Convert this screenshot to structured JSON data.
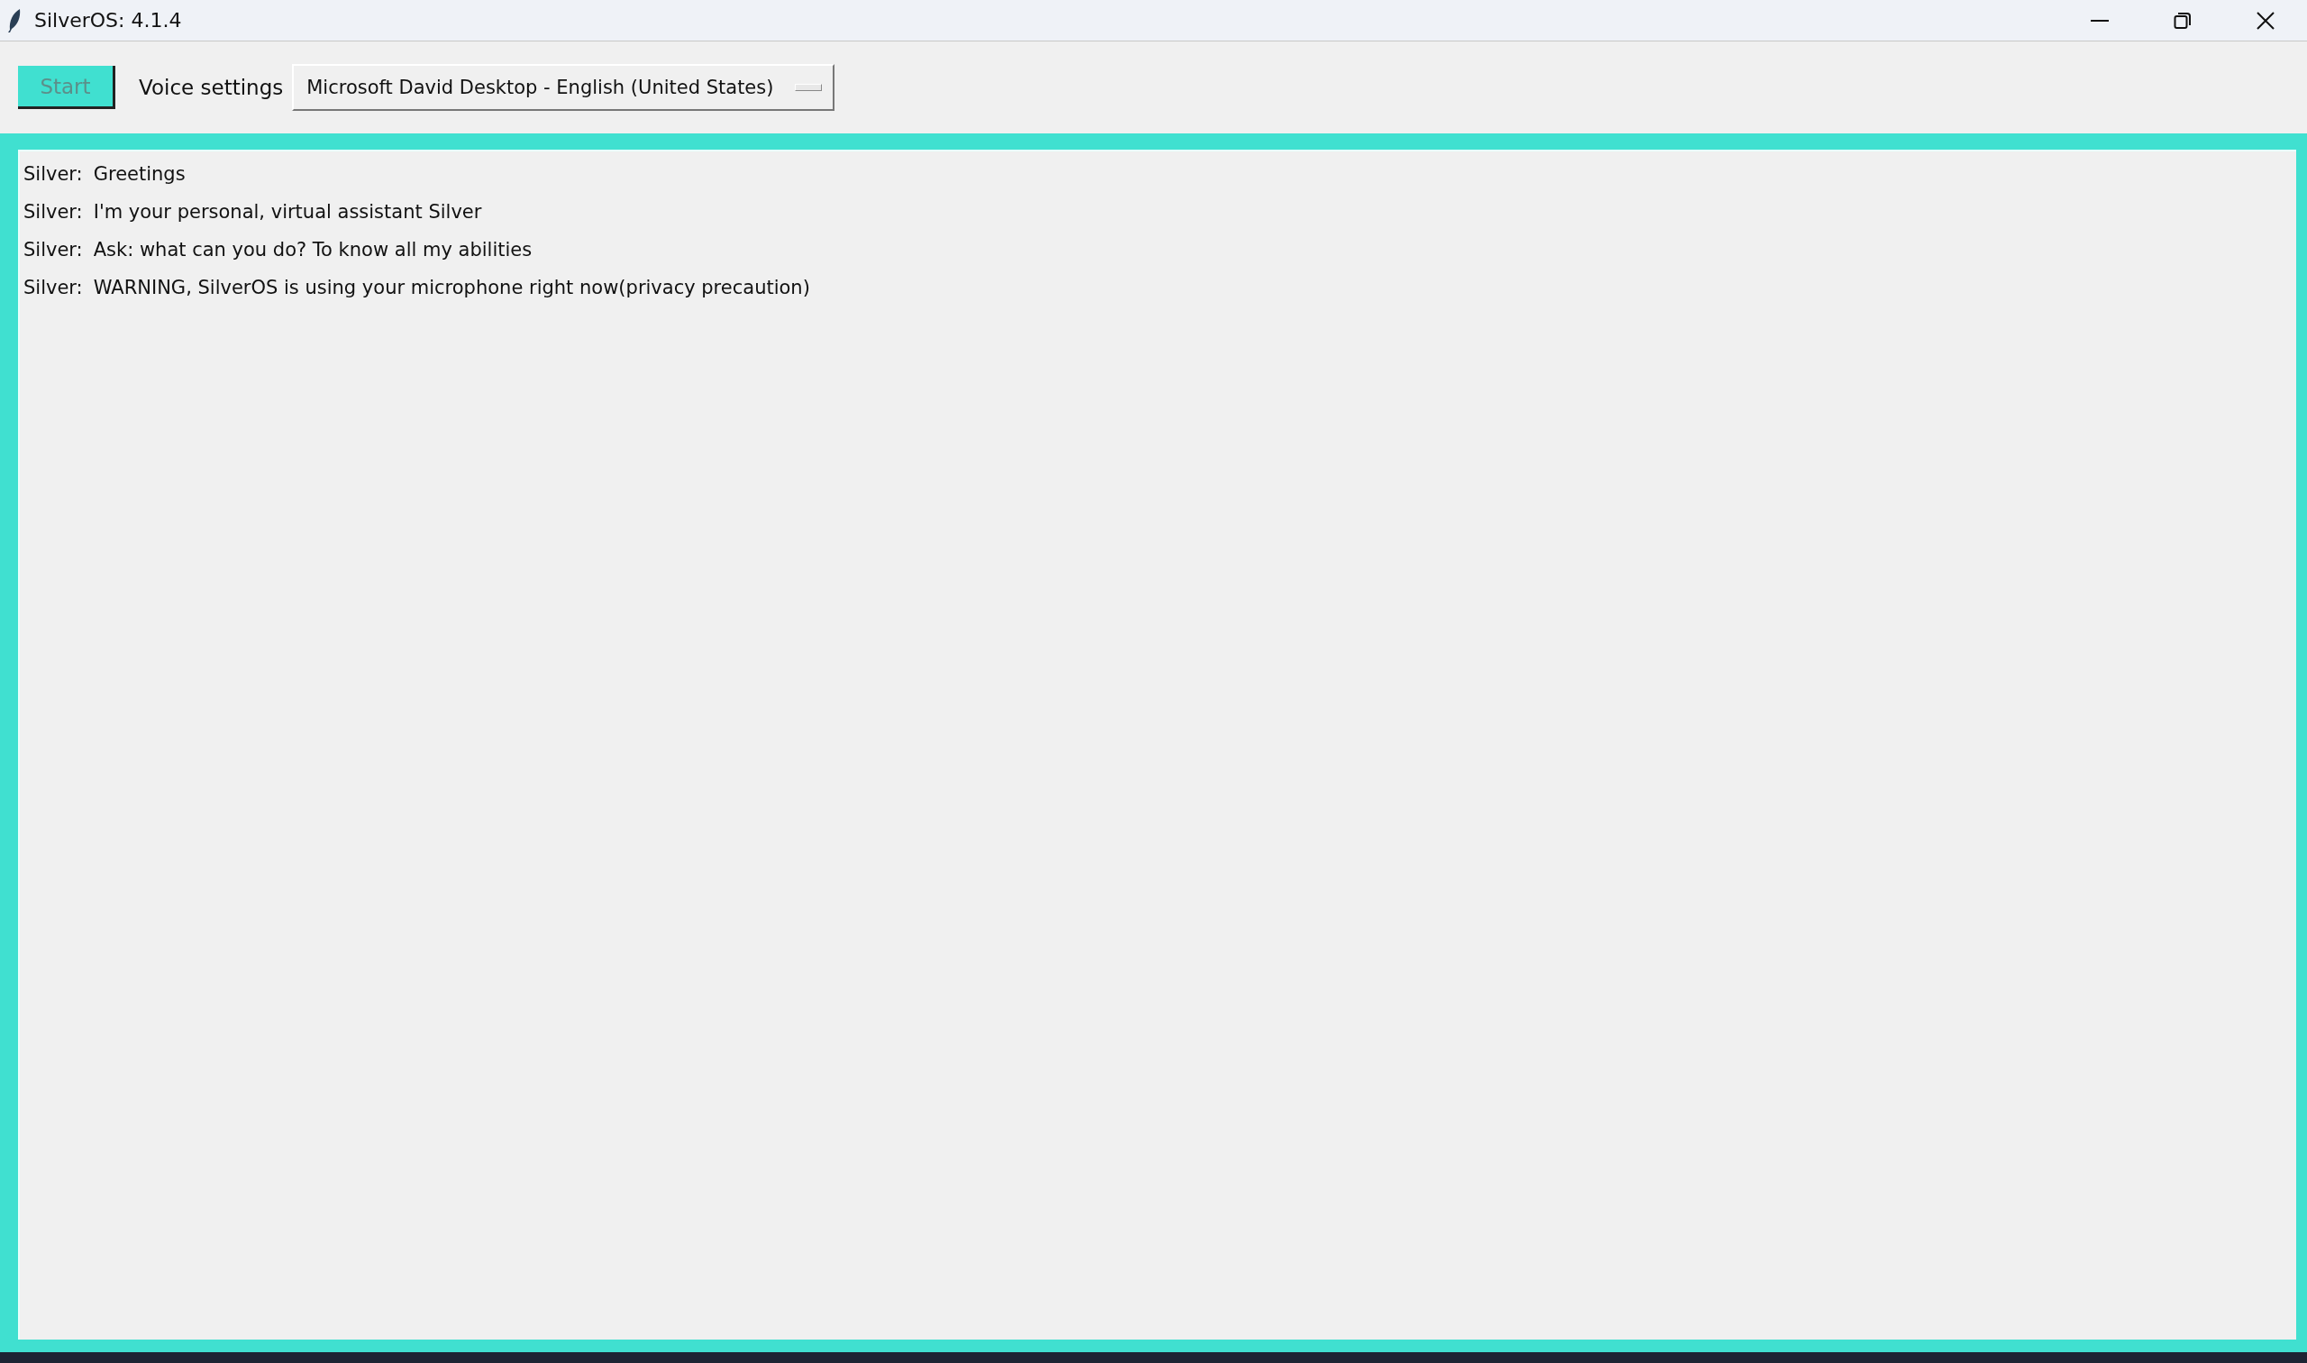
{
  "window": {
    "title": "SilverOS: 4.1.4"
  },
  "toolbar": {
    "start_button": {
      "label": "Start",
      "disabled": true
    },
    "voice_label": "Voice settings",
    "voice_select": {
      "value": "Microsoft David Desktop - English (United States)"
    }
  },
  "messages": [
    {
      "speaker": "Silver:",
      "text": "Greetings"
    },
    {
      "speaker": "Silver:",
      "text": "I'm your personal, virtual assistant Silver"
    },
    {
      "speaker": "Silver:",
      "text": "Ask: what can you do? To know all my abilities"
    },
    {
      "speaker": "Silver:",
      "text": "WARNING, SilverOS is using your microphone right now(privacy precaution)"
    }
  ]
}
